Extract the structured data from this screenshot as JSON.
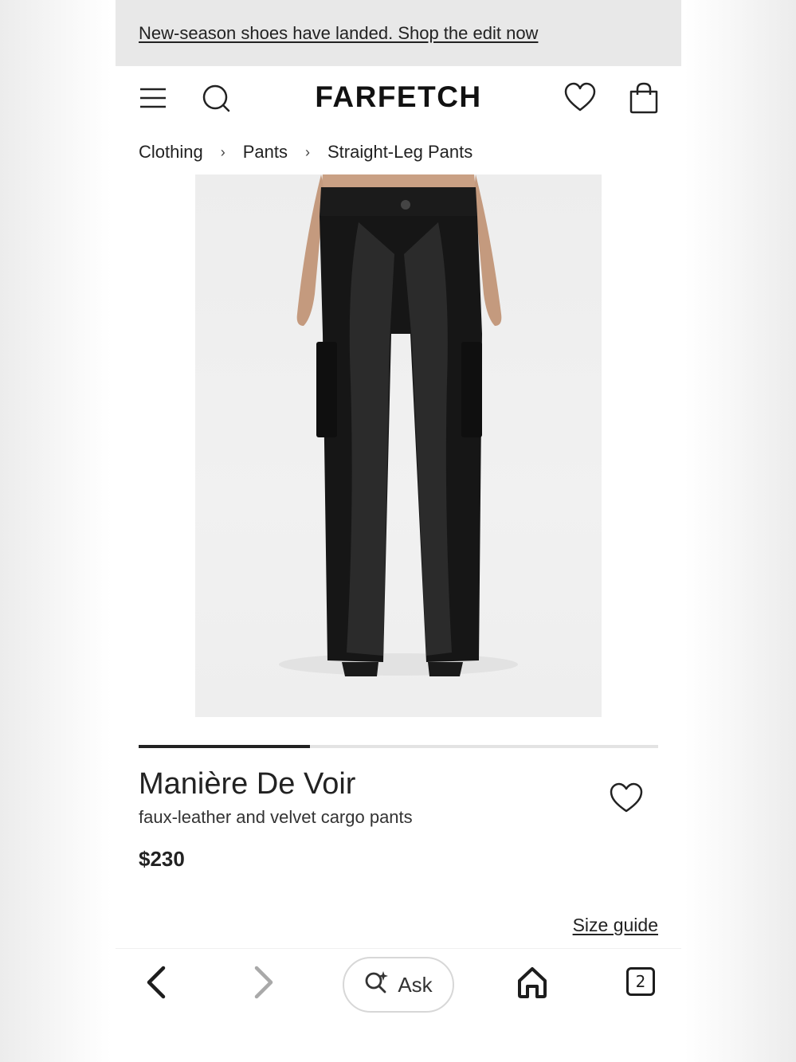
{
  "promo": {
    "text": "New-season shoes have landed. Shop the edit now"
  },
  "header": {
    "logo": "FARFETCH"
  },
  "breadcrumb": [
    {
      "label": "Clothing"
    },
    {
      "label": "Pants"
    },
    {
      "label": "Straight-Leg Pants"
    }
  ],
  "breadcrumb_separator": "›",
  "gallery": {
    "progress": 0.33
  },
  "product": {
    "brand": "Manière De Voir",
    "description": "faux-leather and velvet cargo pants",
    "price": "$230"
  },
  "size_guide": "Size guide",
  "browser": {
    "ask_label": "Ask",
    "tab_count": "2"
  },
  "icons": {
    "menu": "menu-icon",
    "search": "search-icon",
    "wishlist": "heart-icon",
    "bag": "shopping-bag-icon",
    "back": "chevron-left-icon",
    "forward": "chevron-right-icon",
    "ask": "ai-search-icon",
    "home": "home-icon",
    "tabs": "tabs-icon"
  }
}
